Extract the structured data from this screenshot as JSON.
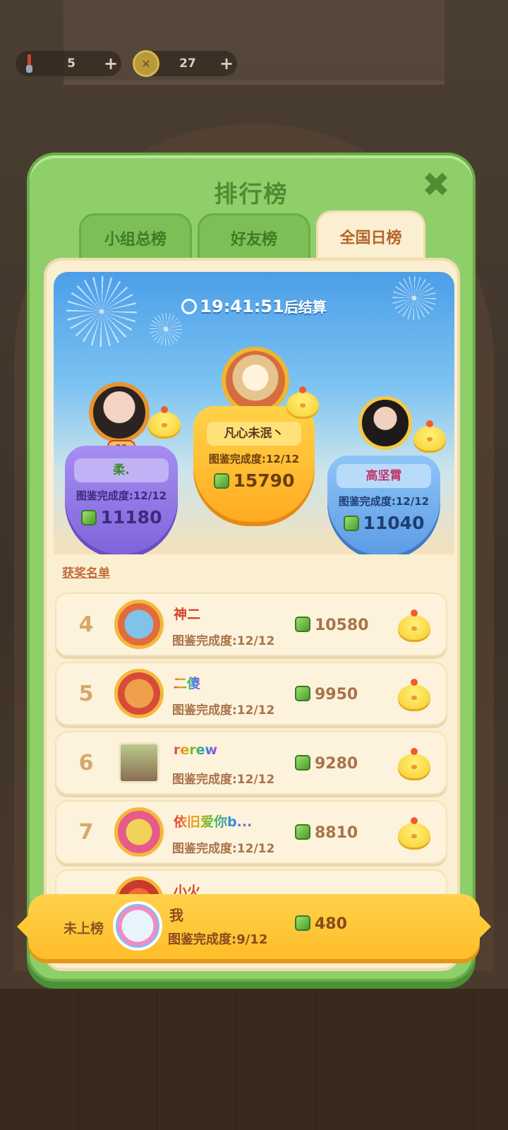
{
  "resources": {
    "items": [
      {
        "icon": "brush-icon",
        "value": "5"
      },
      {
        "icon": "coin-icon",
        "value": "27"
      }
    ]
  },
  "dialog": {
    "title": "排行榜",
    "tabs": [
      {
        "label": "小组总榜",
        "active": false
      },
      {
        "label": "好友榜",
        "active": false
      },
      {
        "label": "全国日榜",
        "active": true
      }
    ]
  },
  "podium": {
    "timer": "19:41:51",
    "timer_suffix": "后结算",
    "level_badge": "99",
    "top3": [
      {
        "rank": 2,
        "name": "柔.",
        "progress": "图鉴完成度:12/12",
        "score": "11180"
      },
      {
        "rank": 1,
        "name": "凡心未泯丶",
        "progress": "图鉴完成度:12/12",
        "score": "15790"
      },
      {
        "rank": 3,
        "name": "高坚霄",
        "progress": "图鉴完成度:12/12",
        "score": "11040"
      }
    ]
  },
  "award_list": {
    "title": "获奖名单",
    "rows": [
      {
        "rank": "4",
        "name": "神二",
        "progress": "图鉴完成度:12/12",
        "score": "10580"
      },
      {
        "rank": "5",
        "name": "二傻",
        "progress": "图鉴完成度:12/12",
        "score": "9950"
      },
      {
        "rank": "6",
        "name": "rerew",
        "progress": "图鉴完成度:12/12",
        "score": "9280"
      },
      {
        "rank": "7",
        "name": "依旧爱你b...",
        "progress": "图鉴完成度:12/12",
        "score": "8810"
      },
      {
        "rank": "",
        "name": "小火",
        "progress": "",
        "score": ""
      }
    ]
  },
  "me": {
    "rank": "未上榜",
    "name": "我",
    "progress": "图鉴完成度:9/12",
    "score": "480"
  },
  "colors": {
    "dialog_green": "#8fcf6a",
    "panel_cream": "#fbefd1",
    "accent_orange": "#b5652a"
  }
}
